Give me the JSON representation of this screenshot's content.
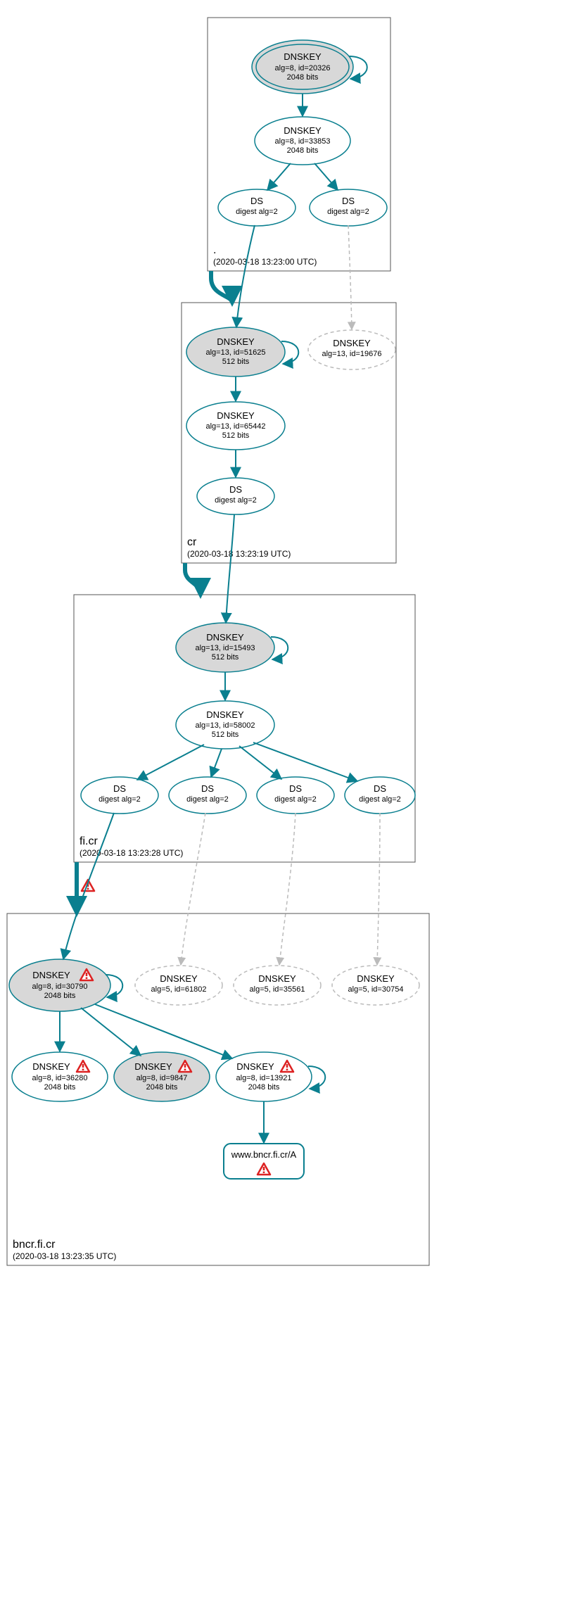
{
  "zones": {
    "root": {
      "name": ".",
      "time": "(2020-03-18 13:23:00 UTC)"
    },
    "cr": {
      "name": "cr",
      "time": "(2020-03-18 13:23:19 UTC)"
    },
    "ficr": {
      "name": "fi.cr",
      "time": "(2020-03-18 13:23:28 UTC)"
    },
    "bncr": {
      "name": "bncr.fi.cr",
      "time": "(2020-03-18 13:23:35 UTC)"
    }
  },
  "nodes": {
    "root_ksk": {
      "title": "DNSKEY",
      "l1": "alg=8, id=20326",
      "l2": "2048 bits"
    },
    "root_zsk": {
      "title": "DNSKEY",
      "l1": "alg=8, id=33853",
      "l2": "2048 bits"
    },
    "root_ds1": {
      "title": "DS",
      "l1": "digest alg=2"
    },
    "root_ds2": {
      "title": "DS",
      "l1": "digest alg=2"
    },
    "cr_ksk": {
      "title": "DNSKEY",
      "l1": "alg=13, id=51625",
      "l2": "512 bits"
    },
    "cr_other": {
      "title": "DNSKEY",
      "l1": "alg=13, id=19676"
    },
    "cr_zsk": {
      "title": "DNSKEY",
      "l1": "alg=13, id=65442",
      "l2": "512 bits"
    },
    "cr_ds": {
      "title": "DS",
      "l1": "digest alg=2"
    },
    "ficr_ksk": {
      "title": "DNSKEY",
      "l1": "alg=13, id=15493",
      "l2": "512 bits"
    },
    "ficr_zsk": {
      "title": "DNSKEY",
      "l1": "alg=13, id=58002",
      "l2": "512 bits"
    },
    "ficr_ds1": {
      "title": "DS",
      "l1": "digest alg=2"
    },
    "ficr_ds2": {
      "title": "DS",
      "l1": "digest alg=2"
    },
    "ficr_ds3": {
      "title": "DS",
      "l1": "digest alg=2"
    },
    "ficr_ds4": {
      "title": "DS",
      "l1": "digest alg=2"
    },
    "bncr_ksk": {
      "title": "DNSKEY",
      "l1": "alg=8, id=30790",
      "l2": "2048 bits"
    },
    "bncr_d1": {
      "title": "DNSKEY",
      "l1": "alg=5, id=61802"
    },
    "bncr_d2": {
      "title": "DNSKEY",
      "l1": "alg=5, id=35561"
    },
    "bncr_d3": {
      "title": "DNSKEY",
      "l1": "alg=5, id=30754"
    },
    "bncr_k36280": {
      "title": "DNSKEY",
      "l1": "alg=8, id=36280",
      "l2": "2048 bits"
    },
    "bncr_k9847": {
      "title": "DNSKEY",
      "l1": "alg=8, id=9847",
      "l2": "2048 bits"
    },
    "bncr_k13921": {
      "title": "DNSKEY",
      "l1": "alg=8, id=13921",
      "l2": "2048 bits"
    },
    "bncr_rr": {
      "title": "www.bncr.fi.cr/A"
    }
  }
}
